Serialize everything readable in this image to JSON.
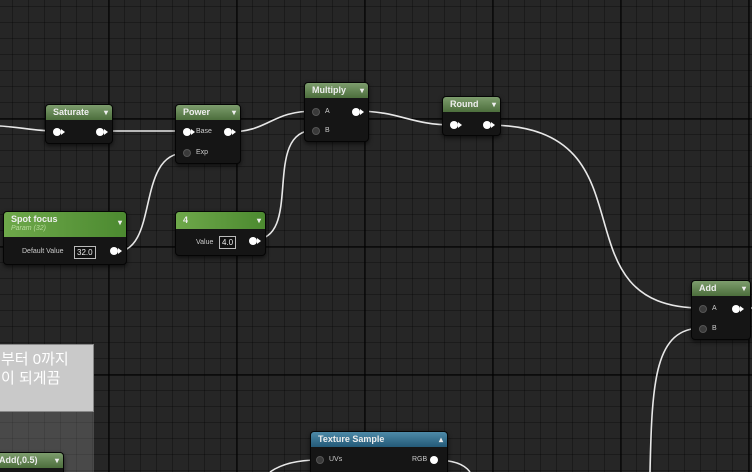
{
  "nodes": {
    "saturate": {
      "title": "Saturate"
    },
    "power": {
      "title": "Power",
      "pins": [
        "Base",
        "Exp"
      ]
    },
    "multiply": {
      "title": "Multiply",
      "pins": [
        "A",
        "B"
      ]
    },
    "round": {
      "title": "Round"
    },
    "spot_focus": {
      "title": "Spot focus",
      "subtitle": "Param (32)",
      "pin_label": "Default Value",
      "value": "32.0"
    },
    "constant": {
      "title": "4",
      "pin_label": "Value",
      "value": "4.0"
    },
    "add": {
      "title": "Add",
      "pins": [
        "A",
        "B"
      ]
    },
    "texture_sample": {
      "title": "Texture Sample",
      "input_pin": "UVs",
      "output_pin": "RGB"
    },
    "add_partial": {
      "title": "Add(,0.5)"
    }
  },
  "comment": {
    "line1": "부터 0까지",
    "line2": "이 되게끔"
  },
  "colors": {
    "canvas": "#262626",
    "header_green": "#5a7d4a",
    "header_param": "#5e9a3c",
    "header_texture": "#2f6b8a",
    "wire": "#ffffff",
    "comment_bg": "#c9c9c9"
  },
  "icons": {
    "collapse": "chevron-down-icon",
    "expand": "chevron-up-icon",
    "exec_out": "triangle-right-icon"
  }
}
